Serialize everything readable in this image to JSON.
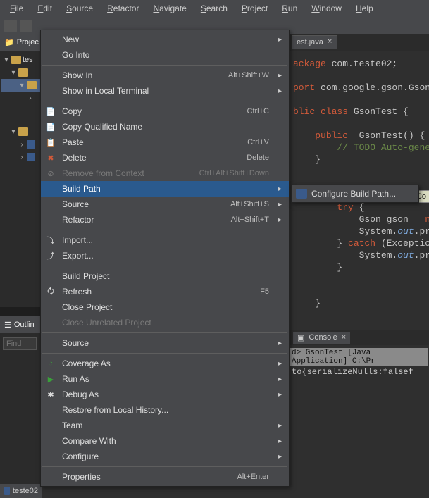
{
  "menubar": [
    "File",
    "Edit",
    "Source",
    "Refactor",
    "Navigate",
    "Search",
    "Project",
    "Run",
    "Window",
    "Help"
  ],
  "projectExplorer": {
    "title": "Projec",
    "rootItem": "tes",
    "bottomTab": "teste02"
  },
  "outline": {
    "title": "Outlin",
    "findPlaceholder": "Find"
  },
  "editor": {
    "activeTab": "est.java",
    "code": {
      "l1": {
        "s1": "ackage",
        "s2": " com.teste02;"
      },
      "l2": {
        "s1": "port",
        "s2": " com.google.gson.Gson"
      },
      "l3": {
        "s1": "blic class",
        "s2": " GsonTest",
        "s3": " {"
      },
      "l4": {
        "s1": "public",
        "s2": " GsonTest",
        "s3": "() {"
      },
      "l5": "// TODO Auto-genera",
      "l6": "}",
      "l7": {
        "s1": "try",
        "s2": " {"
      },
      "l8": {
        "s1": "Gson",
        "s2": " gson = ",
        "s3": "n"
      },
      "l9": {
        "s1": "System.",
        "s2": "out",
        "s3": ".prin"
      },
      "l10": {
        "s1": "} ",
        "s2": "catch",
        "s3": " (Exception "
      },
      "l11": {
        "s1": "System.",
        "s2": "out",
        "s3": ".prin"
      },
      "l12": "}",
      "l13": "}"
    }
  },
  "coBadge": "Co",
  "console": {
    "tabLabel": "Console",
    "header": "d> GsonTest [Java Application] C:\\Pr",
    "output": "to{serializeNulls:falsef"
  },
  "contextMenu": {
    "items": [
      {
        "label": "New",
        "arrow": true
      },
      {
        "label": "Go Into"
      },
      {
        "sep": true
      },
      {
        "label": "Show In",
        "hint": "Alt+Shift+W",
        "arrow": true
      },
      {
        "label": "Show in Local Terminal",
        "arrow": true
      },
      {
        "sep": true
      },
      {
        "label": "Copy",
        "hint": "Ctrl+C",
        "icon": "copy"
      },
      {
        "label": "Copy Qualified Name",
        "icon": "copyq"
      },
      {
        "label": "Paste",
        "hint": "Ctrl+V",
        "icon": "paste"
      },
      {
        "label": "Delete",
        "hint": "Delete",
        "icon": "delete"
      },
      {
        "label": "Remove from Context",
        "hint": "Ctrl+Alt+Shift+Down",
        "disabled": true,
        "icon": "remove"
      },
      {
        "label": "Build Path",
        "arrow": true,
        "selected": true
      },
      {
        "label": "Source",
        "hint": "Alt+Shift+S",
        "arrow": true
      },
      {
        "label": "Refactor",
        "hint": "Alt+Shift+T",
        "arrow": true
      },
      {
        "sep": true
      },
      {
        "label": "Import...",
        "icon": "import"
      },
      {
        "label": "Export...",
        "icon": "export"
      },
      {
        "sep": true
      },
      {
        "label": "Build Project"
      },
      {
        "label": "Refresh",
        "hint": "F5",
        "icon": "refresh"
      },
      {
        "label": "Close Project"
      },
      {
        "label": "Close Unrelated Project",
        "disabled": true
      },
      {
        "sep": true
      },
      {
        "label": "Source",
        "arrow": true
      },
      {
        "sep": true
      },
      {
        "label": "Coverage As",
        "arrow": true,
        "icon": "coverage"
      },
      {
        "label": "Run As",
        "arrow": true,
        "icon": "run"
      },
      {
        "label": "Debug As",
        "arrow": true,
        "icon": "debug"
      },
      {
        "label": "Restore from Local History..."
      },
      {
        "label": "Team",
        "arrow": true
      },
      {
        "label": "Compare With",
        "arrow": true
      },
      {
        "label": "Configure",
        "arrow": true
      },
      {
        "sep": true
      },
      {
        "label": "Properties",
        "hint": "Alt+Enter"
      }
    ]
  },
  "submenu": {
    "item": "Configure Build Path..."
  }
}
